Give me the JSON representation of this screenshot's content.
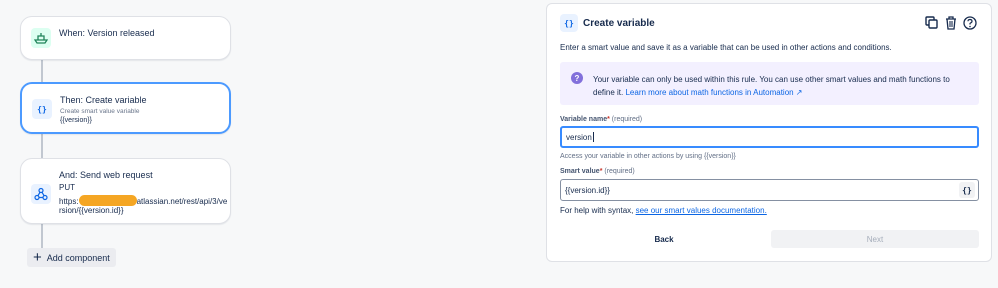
{
  "flow": {
    "trigger": {
      "title": "When: Version released",
      "icon": "ship-icon"
    },
    "action_variable": {
      "title": "Then: Create variable",
      "subtitle": "Create smart value variable",
      "meta": "{{version}}",
      "icon": "braces-icon"
    },
    "action_webrequest": {
      "title": "And: Send web request",
      "method": "PUT",
      "url_prefix": "https:",
      "url_suffix": "atlassian.net/rest/api/3/ve",
      "url_line2": "rsion/{{version.id}}",
      "icon": "webhook-icon"
    },
    "add_component_label": "Add component"
  },
  "panel": {
    "title": "Create variable",
    "badge": "{}",
    "description": "Enter a smart value and save it as a variable that can be used in other actions and conditions.",
    "info": {
      "text": "Your variable can only be used within this rule. You can use other smart values and math functions to define it.",
      "link": "Learn more about math functions in Automation ↗"
    },
    "variable_name": {
      "label": "Variable name",
      "required_note": "(required)",
      "value": "version",
      "helper": "Access your variable in other actions by using {{version}}"
    },
    "smart_value": {
      "label": "Smart value",
      "required_note": "(required)",
      "value": "{{version.id}}",
      "button": "{}"
    },
    "syntax_help": {
      "text": "For help with syntax,",
      "link": "see our smart values documentation."
    },
    "back_label": "Back",
    "next_label": "Next",
    "header_icons": [
      "copy-icon",
      "trash-icon",
      "help-icon"
    ]
  },
  "colors": {
    "selected_border": "#4c9aff",
    "info_bg": "#f3f0ff",
    "link": "#0c66e4",
    "redaction": "#f5a623"
  }
}
